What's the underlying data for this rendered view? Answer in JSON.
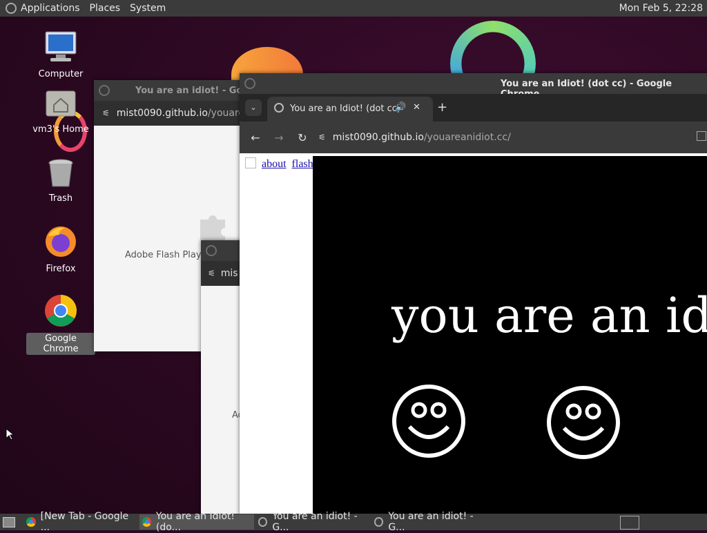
{
  "top_panel": {
    "menus": [
      "Applications",
      "Places",
      "System"
    ],
    "clock": "Mon Feb  5, 22:28"
  },
  "desktop_icons": [
    {
      "label": "Computer",
      "icon": "computer-icon"
    },
    {
      "label": "vm3's Home",
      "icon": "home-folder-icon"
    },
    {
      "label": "Trash",
      "icon": "trash-icon"
    },
    {
      "label": "Firefox",
      "icon": "firefox-icon"
    },
    {
      "label": "Google Chrome",
      "icon": "chrome-icon",
      "selected": true
    }
  ],
  "window_back": {
    "title": "You are an idiot! - Googl",
    "url_host": "mist0090.github.io",
    "url_path": "/youarea",
    "plugin_text": "Adobe Flash Playe"
  },
  "window_middle": {
    "url_host": "mis",
    "plugin_text": "Ad"
  },
  "window_main": {
    "title": "You are an Idiot! (dot cc) - Google Chrome",
    "tab_title": "You are an Idiot! (dot cc)",
    "url_host": "mist0090.github.io",
    "url_path": "/youareanidiot.cc/",
    "links": [
      "about",
      "flash"
    ],
    "page_text": "you are an idiot!"
  },
  "taskbar": {
    "items": [
      {
        "label": "[New Tab - Google ...",
        "active": false
      },
      {
        "label": "You are an Idiot! (do...",
        "active": true
      },
      {
        "label": "You are an idiot! - G...",
        "active": false
      },
      {
        "label": "You are an idiot! - G...",
        "active": false
      }
    ]
  }
}
